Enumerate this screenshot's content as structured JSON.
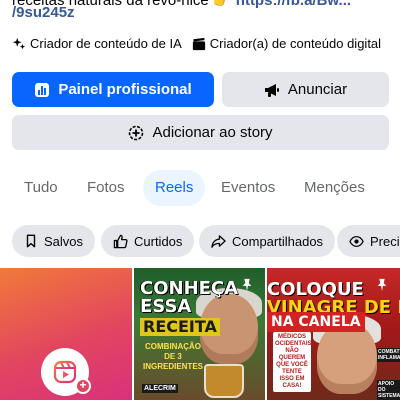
{
  "bio": {
    "text_partial": "receitas naturais da revo-nice",
    "link_partial": "https://fb.a/Bw...",
    "link_line": "/9su245z"
  },
  "creator_tags": [
    {
      "icon": "sparkle-icon",
      "label": "Criador de conteúdo de IA"
    },
    {
      "icon": "clapperboard-icon",
      "label": "Criador(a) de conteúdo digital"
    }
  ],
  "actions": {
    "dashboard": {
      "icon": "chart-icon",
      "label": "Painel profissional"
    },
    "advertise": {
      "icon": "megaphone-icon",
      "label": "Anunciar"
    },
    "story": {
      "icon": "add-story-icon",
      "label": "Adicionar ao story"
    }
  },
  "tabs": [
    {
      "label": "Tudo",
      "active": false
    },
    {
      "label": "Fotos",
      "active": false
    },
    {
      "label": "Reels",
      "active": true
    },
    {
      "label": "Eventos",
      "active": false
    },
    {
      "label": "Menções",
      "active": false
    }
  ],
  "filters": [
    {
      "icon": "bookmark-icon",
      "label": "Salvos"
    },
    {
      "icon": "thumbs-up-icon",
      "label": "Curtidos"
    },
    {
      "icon": "share-icon",
      "label": "Compartilhados"
    },
    {
      "icon": "eye-icon",
      "label": "Preci"
    }
  ],
  "reels": [
    {
      "type": "create",
      "icon": "reels-icon"
    },
    {
      "type": "reel",
      "pinned": true,
      "lines": [
        "CONHEÇA",
        "ESSA",
        "RECEITA"
      ],
      "subtitle": "COMBINAÇÃO DE 3 INGREDIENTES",
      "small": "ALECRIM"
    },
    {
      "type": "reel",
      "pinned": true,
      "lines": [
        "COLOQUE",
        "VINAGRE DE MAÇÃ",
        "NA CANELA"
      ],
      "badge": "MÉDICOS OCIDENTAIS NÃO QUEREM QUE VOCÊ TENTE ISSO EM CASA!",
      "side_top": "COMBATE INFLAMAÇÃO",
      "side_bottom": "APOIO DO SISTEMA"
    }
  ],
  "colors": {
    "primary": "#0866ff",
    "secondary_bg": "#e4e6eb",
    "text_muted": "#65676b",
    "active_tab_bg": "#ebf5ff",
    "link": "#385898"
  }
}
